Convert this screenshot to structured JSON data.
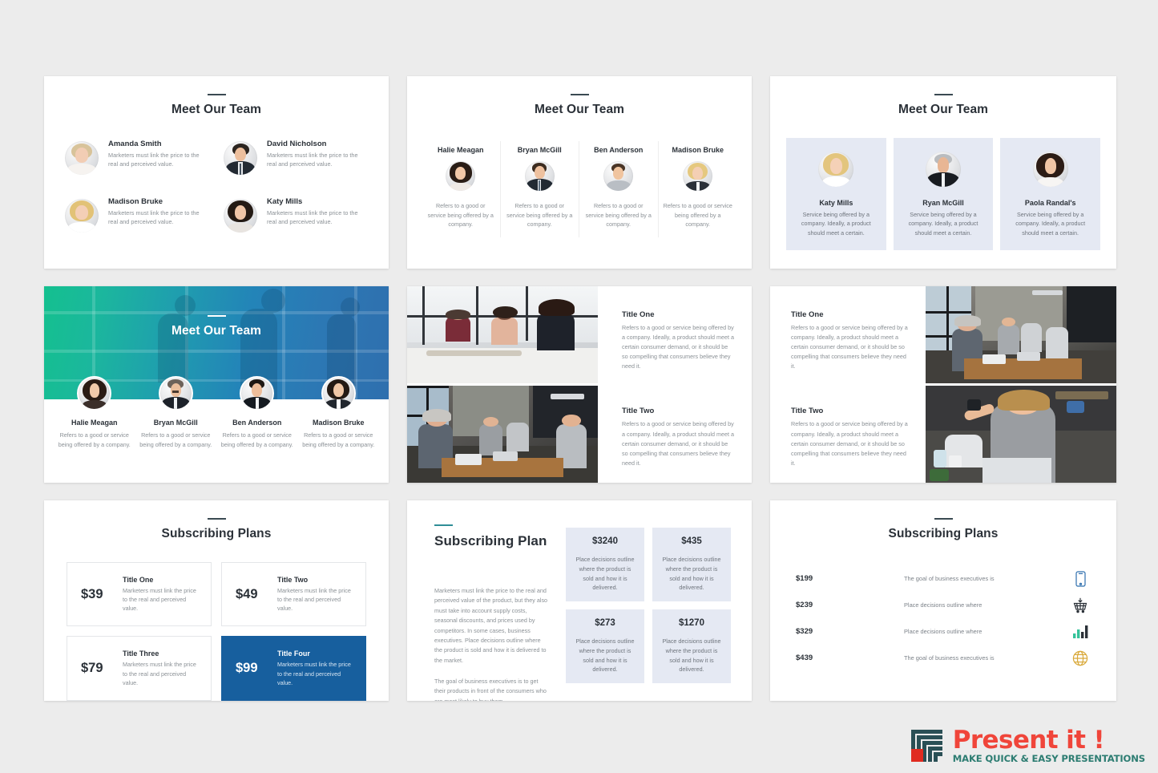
{
  "slides": [
    {
      "id": "team-two-column",
      "title": "Meet Our Team",
      "members": [
        {
          "name": "Amanda Smith",
          "desc": "Marketers must link the price to the real and perceived value."
        },
        {
          "name": "David Nicholson",
          "desc": "Marketers must link the price to the real and perceived value."
        },
        {
          "name": "Madison Bruke",
          "desc": "Marketers must link the price to the real and perceived value."
        },
        {
          "name": "Katy Mills",
          "desc": "Marketers must link the price to the real and perceived value."
        }
      ]
    },
    {
      "id": "team-four-column",
      "title": "Meet Our Team",
      "members": [
        {
          "name": "Halie Meagan",
          "desc": "Refers to a good or service being offered by a company."
        },
        {
          "name": "Bryan McGill",
          "desc": "Refers to a good or service being offered by a company."
        },
        {
          "name": "Ben Anderson",
          "desc": "Refers to a good or service being offered by a company."
        },
        {
          "name": "Madison Bruke",
          "desc": "Refers to a good or service being offered by a company."
        }
      ]
    },
    {
      "id": "team-cards",
      "title": "Meet Our Team",
      "card_color": "#e5e9f3",
      "members": [
        {
          "name": "Katy Mills",
          "desc": "Service being offered by a company. Ideally, a product should meet a certain."
        },
        {
          "name": "Ryan McGill",
          "desc": "Service being offered by a company. Ideally, a product should meet a certain."
        },
        {
          "name": "Paola Randal's",
          "desc": "Service being offered by a company. Ideally, a product should meet a certain."
        }
      ]
    },
    {
      "id": "team-gradient",
      "title": "Meet Our Team",
      "gradient_from": "#14c08f",
      "gradient_to": "#2f6fae",
      "members": [
        {
          "name": "Halie Meagan",
          "desc": "Refers to a good or service being offered by a company."
        },
        {
          "name": "Bryan McGill",
          "desc": "Refers to a good or service being offered by a company."
        },
        {
          "name": "Ben Anderson",
          "desc": "Refers to a good or service being offered by a company."
        },
        {
          "name": "Madison Bruke",
          "desc": "Refers to a good or service being offered by a company."
        }
      ]
    },
    {
      "id": "photo-left-text-right",
      "blocks": [
        {
          "title": "Title One",
          "body": "Refers to a good or service being offered by a company. Ideally, a product should meet a certain consumer demand, or it should be so compelling that consumers believe they need it."
        },
        {
          "title": "Title Two",
          "body": "Refers to a good or service being offered by a company. Ideally, a product should meet a certain consumer demand, or it should be so compelling that consumers believe they need it."
        }
      ],
      "photos": [
        "meeting-room-three-women",
        "office-team-laptops"
      ]
    },
    {
      "id": "text-left-photo-right",
      "blocks": [
        {
          "title": "Title One",
          "body": "Refers to a good or service being offered by a company. Ideally, a product should meet a certain consumer demand, or it should be so compelling that consumers believe they need it."
        },
        {
          "title": "Title Two",
          "body": "Refers to a good or service being offered by a company. Ideally, a product should meet a certain consumer demand, or it should be so compelling that consumers believe they need it."
        }
      ],
      "photos": [
        "long-table-team-working",
        "woman-smiling-at-laptop"
      ]
    },
    {
      "id": "subscribing-plans-grid",
      "title": "Subscribing Plans",
      "featured_color": "#175f9e",
      "plans": [
        {
          "price": "$39",
          "title": "Title One",
          "desc": "Marketers must link the price to the real and perceived value.",
          "featured": false
        },
        {
          "price": "$49",
          "title": "Title Two",
          "desc": "Marketers must link the price to the real and perceived value.",
          "featured": false
        },
        {
          "price": "$79",
          "title": "Title Three",
          "desc": "Marketers must link the price to the real and perceived value.",
          "featured": false
        },
        {
          "price": "$99",
          "title": "Title Four",
          "desc": "Marketers must link the price to the real and perceived value.",
          "featured": true
        }
      ]
    },
    {
      "id": "subscribing-plan-detail",
      "title": "Subscribing Plan",
      "accent": "#2f8e97",
      "paragraphs": [
        "Marketers must link the price to the real and perceived value of the product, but they also must take into account supply costs, seasonal discounts, and prices used by competitors. In some cases, business executives. Place decisions outline where the product is sold and how it is delivered to the market.",
        "The goal of business executives is to get their products in front of the consumers who are most likely to buy them."
      ],
      "cards": [
        {
          "amount": "$3240",
          "text": "Place decisions outline where the product is sold and how it is delivered."
        },
        {
          "amount": "$435",
          "text": "Place decisions outline where the product is sold and how it is delivered."
        },
        {
          "amount": "$273",
          "text": "Place decisions outline where the product is sold and how it is delivered."
        },
        {
          "amount": "$1270",
          "text": "Place decisions outline where the product is sold and how it is delivered."
        }
      ]
    },
    {
      "id": "subscribing-plans-list",
      "title": "Subscribing Plans",
      "rows": [
        {
          "price": "$199",
          "text": "The goal of business executives is",
          "icon": "mobile-phone-icon",
          "icon_color": "#2f6fae"
        },
        {
          "price": "$239",
          "text": "Place decisions outline where",
          "icon": "shopping-cart-icon",
          "icon_color": "#2b3138"
        },
        {
          "price": "$329",
          "text": "Place decisions outline where",
          "icon": "bar-chart-icon",
          "icon_color": "#35c39a"
        },
        {
          "price": "$439",
          "text": "The goal of business executives is",
          "icon": "globe-icon",
          "icon_color": "#d9a93a"
        }
      ]
    }
  ],
  "logo": {
    "main": "Present it !",
    "sub": "MAKE QUICK & EASY PRESENTATIONS",
    "main_color": "#f0453a",
    "sub_color": "#2d7d72",
    "mark_color": "#2a4f55",
    "mark_accent": "#e02b20"
  }
}
